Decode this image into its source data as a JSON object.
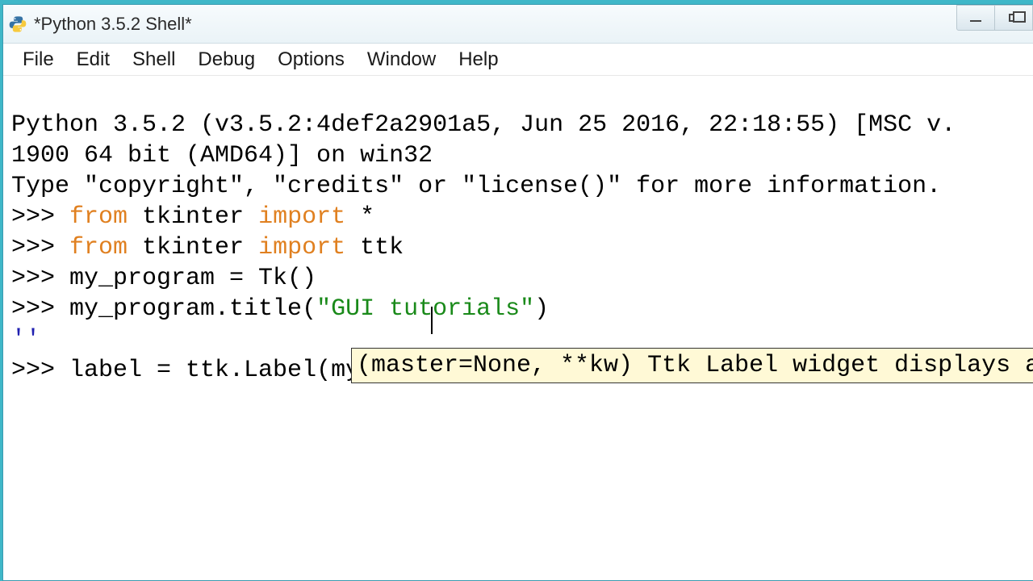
{
  "window": {
    "title": "*Python 3.5.2 Shell*"
  },
  "menu": {
    "file": "File",
    "edit": "Edit",
    "shell": "Shell",
    "debug": "Debug",
    "options": "Options",
    "window": "Window",
    "help": "Help"
  },
  "shell": {
    "banner_line1": "Python 3.5.2 (v3.5.2:4def2a2901a5, Jun 25 2016, 22:18:55) [MSC v.",
    "banner_line2": "1900 64 bit (AMD64)] on win32",
    "banner_line3": "Type \"copyright\", \"credits\" or \"license()\" for more information.",
    "prompt": ">>> ",
    "kw_from": "from",
    "kw_import": "import",
    "mod_tkinter": "tkinter",
    "star": "*",
    "mod_ttk": "ttk",
    "line_tk": "my_program = Tk()",
    "line_title_pre": "my_program.title(",
    "line_title_str": "\"GUI tutorials\"",
    "line_title_post": ")",
    "title_result": "''",
    "line_label": "label = ttk.Label(my_program"
  },
  "calltip": {
    "sig": "(master=None, **kw)",
    "doc": "Ttk Label widget displays a textual label a"
  }
}
